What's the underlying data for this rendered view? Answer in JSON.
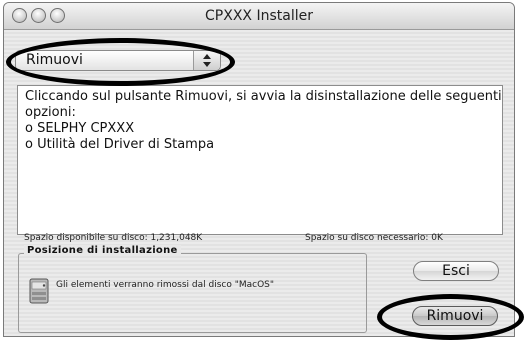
{
  "window": {
    "title": "CPXXX Installer"
  },
  "popup": {
    "selected": "Rimuovi"
  },
  "description": {
    "lines": [
      "Cliccando sul pulsante Rimuovi, si avvia la disinstallazione delle seguenti",
      "opzioni:",
      "o SELPHY CPXXX",
      "o Utilità del Driver di Stampa"
    ]
  },
  "disk": {
    "available": "Spazio disponibile su disco: 1,231,048K",
    "required": "Spazio su disco necessario: 0K"
  },
  "install_location": {
    "title": "Posizione di installazione",
    "message": "Gli elementi verranno rimossi dal disco \"MacOS\""
  },
  "buttons": {
    "quit": "Esci",
    "remove": "Rimuovi"
  },
  "icons": [
    "close-icon",
    "minimize-icon",
    "zoom-icon",
    "popup-arrows-icon",
    "hard-disk-icon"
  ]
}
